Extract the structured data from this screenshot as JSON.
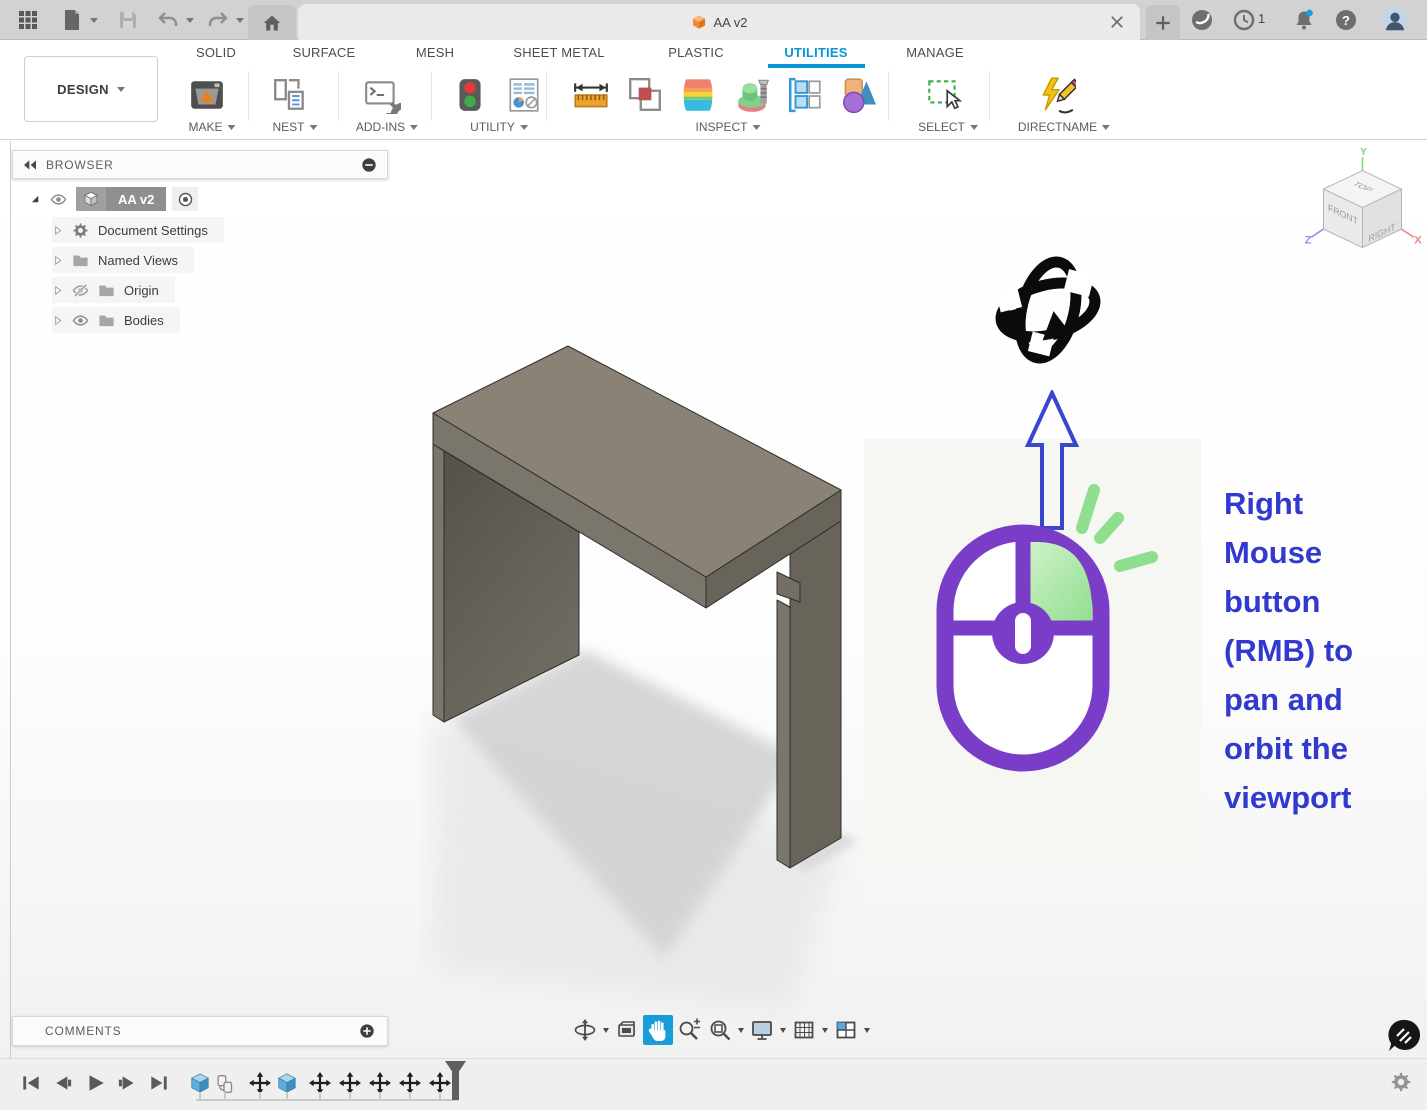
{
  "app": {
    "document_tab_label": "AA v2",
    "job_badge_count": "1"
  },
  "design_menu_label": "DESIGN",
  "tabs": [
    "SOLID",
    "SURFACE",
    "MESH",
    "SHEET METAL",
    "PLASTIC",
    "UTILITIES",
    "MANAGE"
  ],
  "active_tab": "UTILITIES",
  "groups": {
    "make": "MAKE",
    "nest": "NEST",
    "addins": "ADD-INS",
    "utility": "UTILITY",
    "inspect": "INSPECT",
    "select": "SELECT",
    "directname": "DIRECTNAME"
  },
  "browser": {
    "title": "BROWSER",
    "root_label": "AA v2",
    "items": [
      "Document Settings",
      "Named Views",
      "Origin",
      "Bodies"
    ]
  },
  "viewcube": {
    "faces": {
      "top": "TOP",
      "front": "FRONT",
      "right": "RIGHT"
    },
    "axes": {
      "x": "X",
      "y": "Y",
      "z": "Z"
    }
  },
  "annotation": {
    "text": "Right\nMouse\nbutton\n(RMB) to\npan and\norbit the\nviewport",
    "color": "#3239ce"
  },
  "comments_title": "COMMENTS",
  "colors": {
    "accent_blue": "#0a96d6",
    "nav_active_blue": "#189dd8",
    "annotation_blue": "#3239ce",
    "mouse_purple": "#7a3dc8",
    "highlight_green": "#8ede8e",
    "table_top": "#8a8375",
    "table_front": "#7b766c",
    "table_side": "#696459",
    "titlebar_gray": "#d2d2d2"
  }
}
